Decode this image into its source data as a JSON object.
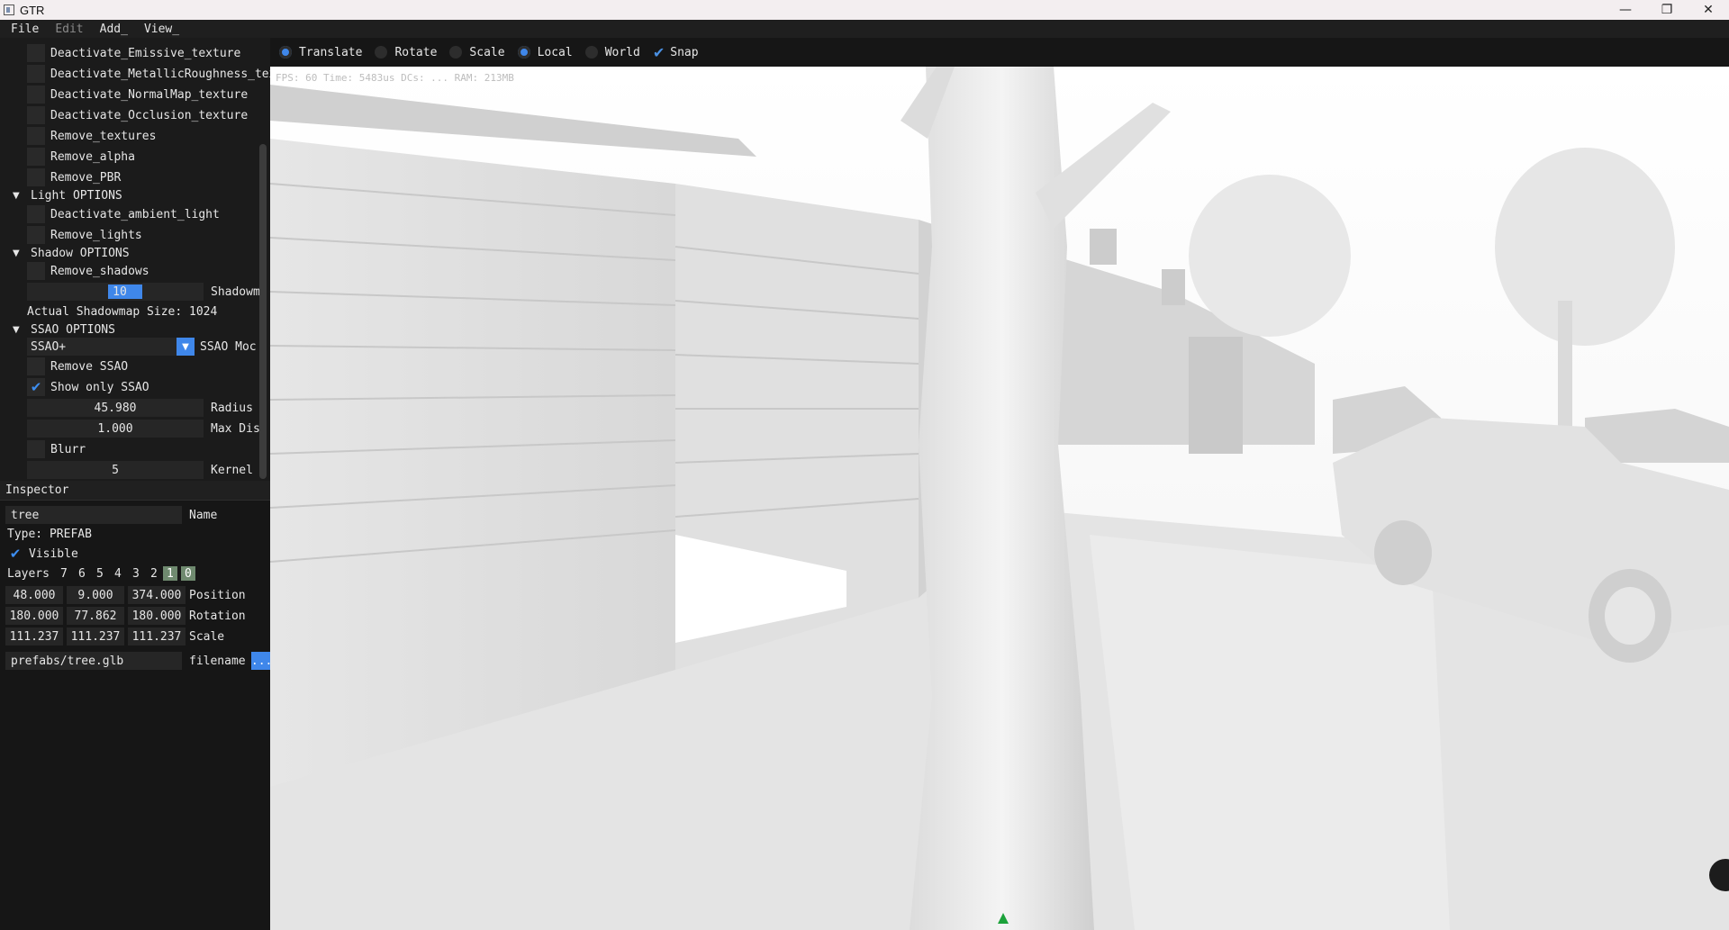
{
  "window": {
    "title": "GTR",
    "controls": [
      "—",
      "❐",
      "✕"
    ]
  },
  "menu": {
    "items": [
      {
        "label": "File",
        "enabled": true
      },
      {
        "label": "Edit",
        "enabled": false
      },
      {
        "label": "Add_",
        "enabled": true
      },
      {
        "label": "View_",
        "enabled": true
      }
    ]
  },
  "options": {
    "texture_items": [
      "Deactivate_Emissive_texture",
      "Deactivate_MetallicRoughness_text",
      "Deactivate_NormalMap_texture",
      "Deactivate_Occlusion_texture",
      "Remove_textures",
      "Remove_alpha",
      "Remove_PBR"
    ],
    "light": {
      "header": "Light OPTIONS",
      "items": [
        "Deactivate_ambient_light",
        "Remove_lights"
      ]
    },
    "shadow": {
      "header": "Shadow OPTIONS",
      "remove_label": "Remove_shadows",
      "slider_value": "10",
      "slider_label": "Shadowma",
      "actual_size": "Actual Shadowmap Size: 1024"
    },
    "ssao": {
      "header": "SSAO OPTIONS",
      "mode_value": "SSAO+",
      "mode_label": "SSAO Moc",
      "remove_label": "Remove SSAO",
      "show_only_label": "Show only SSAO",
      "show_only_checked": true,
      "radius_value": "45.980",
      "radius_label": "Radius",
      "maxdist_value": "1.000",
      "maxdist_label": "Max Dist",
      "blurr_label": "Blurr",
      "kernel_value": "5",
      "kernel_label": "Kernel S"
    }
  },
  "inspector": {
    "title": "Inspector",
    "name_value": "tree",
    "name_label": "Name",
    "type_text": "Type: PREFAB",
    "visible_label": "Visible",
    "visible_checked": true,
    "layers_label": "Layers",
    "layers": [
      "7",
      "6",
      "5",
      "4",
      "3",
      "2",
      "1",
      "0"
    ],
    "layers_active": [
      "1",
      "0"
    ],
    "position": [
      "48.000",
      "9.000",
      "374.000"
    ],
    "position_label": "Position",
    "rotation": [
      "180.000",
      "77.862",
      "180.000"
    ],
    "rotation_label": "Rotation",
    "scale": [
      "111.237",
      "111.237",
      "111.237"
    ],
    "scale_label": "Scale",
    "filename_value": "prefabs/tree.glb",
    "filename_label": "filename",
    "browse_label": "..."
  },
  "toolbar": {
    "translate": {
      "label": "Translate",
      "selected": true
    },
    "rotate": {
      "label": "Rotate",
      "selected": false
    },
    "scale": {
      "label": "Scale",
      "selected": false
    },
    "local": {
      "label": "Local",
      "selected": true
    },
    "world": {
      "label": "World",
      "selected": false
    },
    "snap": {
      "label": "Snap",
      "checked": true
    }
  },
  "stats": "FPS: 60 Time: 5483us DCs: ... RAM: 213MB",
  "colors": {
    "accent": "#3f87ea",
    "panel_bg": "#1b1b1b",
    "viewport_bg": "#ececec",
    "axis_green": "#1ca23b"
  }
}
